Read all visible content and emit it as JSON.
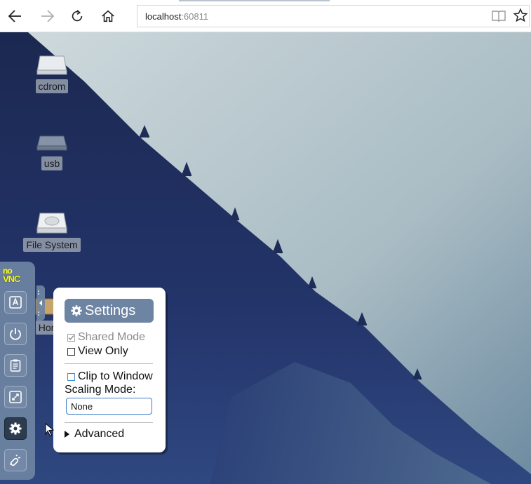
{
  "browser": {
    "url_host": "localhost",
    "url_port": ":60811",
    "back_icon": "back-arrow-icon",
    "forward_icon": "forward-arrow-icon",
    "refresh_icon": "refresh-icon",
    "home_icon": "home-icon",
    "reading_view_icon": "reading-view-icon",
    "favorite_icon": "star-icon"
  },
  "desktop": {
    "icons": [
      {
        "label": "cdrom",
        "icon": "cdrom-drive-icon"
      },
      {
        "label": "usb",
        "icon": "usb-drive-icon"
      },
      {
        "label": "File System",
        "icon": "hard-disk-icon"
      },
      {
        "label": "Hor",
        "icon": "home-folder-icon"
      }
    ]
  },
  "novnc": {
    "logo_top": "no",
    "logo_bottom": "VNC",
    "buttons": [
      {
        "name": "keyboard-button",
        "icon": "keyboard-icon"
      },
      {
        "name": "power-button",
        "icon": "power-icon"
      },
      {
        "name": "clipboard-button",
        "icon": "clipboard-icon"
      },
      {
        "name": "fullscreen-button",
        "icon": "fullscreen-icon"
      },
      {
        "name": "settings-button",
        "icon": "gear-icon"
      },
      {
        "name": "disconnect-button",
        "icon": "disconnect-icon"
      }
    ]
  },
  "settings": {
    "title": "Settings",
    "shared_mode": {
      "label": "Shared Mode",
      "checked": true,
      "disabled": true
    },
    "view_only": {
      "label": "View Only",
      "checked": false
    },
    "clip_to_window": {
      "label": "Clip to Window",
      "checked": false
    },
    "scaling_mode_label": "Scaling Mode:",
    "scaling_mode_value": "None",
    "advanced_label": "Advanced"
  },
  "colors": {
    "panel_accent": "#6e84a3",
    "control_bar": "#6e84a3",
    "logo_yellow": "#f8f81c"
  }
}
